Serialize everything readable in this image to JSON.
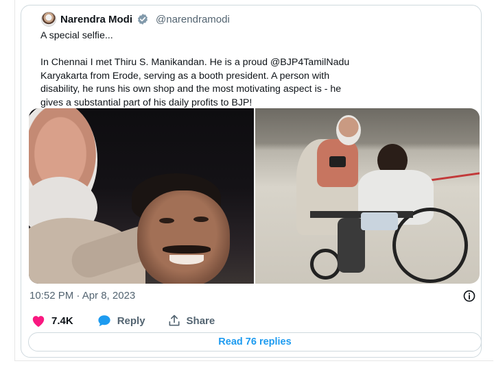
{
  "author": {
    "name": "Narendra Modi",
    "handle": "@narendramodi"
  },
  "tweet": {
    "line1": "A special selfie...",
    "line2": "In Chennai I met Thiru S. Manikandan. He is a proud @BJP4TamilNadu",
    "line3": "Karyakarta from Erode, serving as a booth president. A person with",
    "line4": "disability, he runs his own shop and the most motivating aspect is - he",
    "line5": "gives a substantial part of his daily profits to BJP!"
  },
  "meta": {
    "timestamp": "10:52 PM · Apr 8, 2023"
  },
  "actions": {
    "like_count": "7.4K",
    "reply_label": "Reply",
    "share_label": "Share"
  },
  "footer": {
    "read_replies": "Read 76 replies"
  },
  "colors": {
    "accent": "#1d9bf0",
    "like": "#f91880",
    "verified_badge": "#829aab",
    "secondary_text": "#536471"
  },
  "icons": [
    "verified-badge-icon",
    "info-icon",
    "heart-icon",
    "reply-bubble-icon",
    "share-icon"
  ]
}
